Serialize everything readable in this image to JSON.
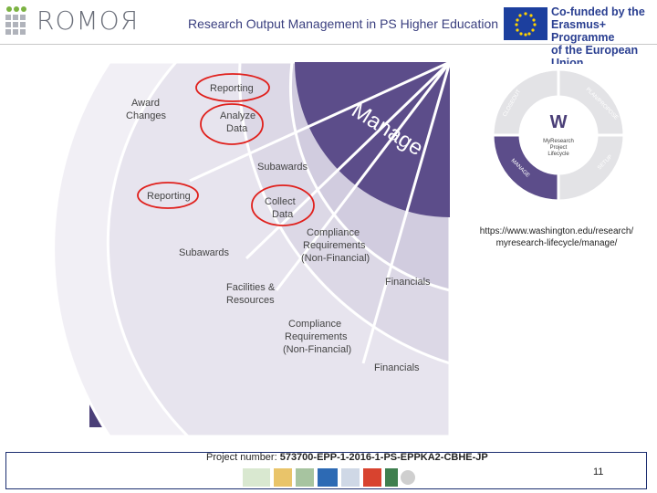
{
  "header": {
    "logo_text": "ROMOЯ",
    "title": "Research Output Management in PS Higher Education",
    "eu_text_line1": "Co-funded by the",
    "eu_text_line2": "Erasmus+ Programme",
    "eu_text_line3": "of the European Union"
  },
  "diagram": {
    "manage_label": "Manage",
    "outer_ring": [
      "Reporting",
      "Analyze Data",
      "Award Changes"
    ],
    "middle_ring": [
      "Subawards",
      "Reporting",
      "Collect Data"
    ],
    "inner_ring": [
      "Compliance Requirements (Non-Financial)",
      "Subawards",
      "Facilities & Resources",
      "Financials"
    ],
    "innermost_ring": [
      "Compliance Requirements (Non-Financial)",
      "Financials"
    ],
    "circled_items": [
      "Reporting",
      "Analyze Data",
      "Reporting",
      "Collect Data"
    ]
  },
  "lifecycle": {
    "center_title": "MyResearch Project Lifecycle",
    "center_logo": "W",
    "segments": [
      "PLAN/PROPOSE",
      "SETUP",
      "MANAGE",
      "CLOSEOUT"
    ]
  },
  "source_url": {
    "line1": "https://www.washington.edu/research/",
    "line2": "myresearch-lifecycle/manage/"
  },
  "footer": {
    "project_label": "Project number: ",
    "project_number": "573700-EPP-1-2016-1-PS-EPPKA2-CBHE-JP",
    "page_number": "11"
  },
  "colors": {
    "brand_purple": "#5c4d8a",
    "ring_light": "#ece9f2",
    "ring_mid": "#dedbe8",
    "circle_red": "#e0201c",
    "header_blue": "#3a3f7f"
  }
}
